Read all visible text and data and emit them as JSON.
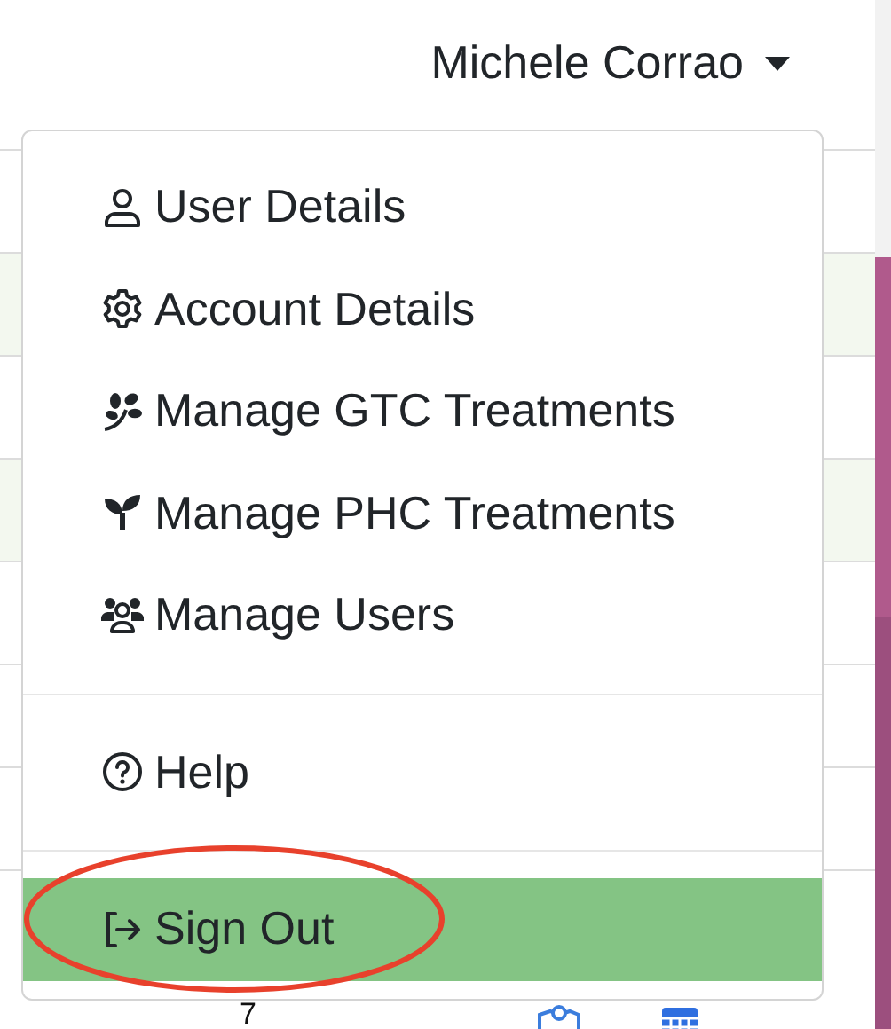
{
  "user_menu": {
    "name": "Michele Corrao",
    "expanded": true
  },
  "menu_sections": [
    {
      "items": [
        {
          "label": "User Details",
          "selected": false
        },
        {
          "label": "Account Details",
          "selected": false
        },
        {
          "label": "Manage GTC Treatments",
          "selected": false
        },
        {
          "label": "Manage PHC Treatments",
          "selected": false
        },
        {
          "label": "Manage Users",
          "selected": false
        }
      ]
    },
    {
      "items": [
        {
          "label": "Help",
          "selected": false
        }
      ]
    },
    {
      "items": [
        {
          "label": "Sign Out",
          "selected": true
        }
      ]
    }
  ],
  "table_row": {
    "column_1": "7"
  },
  "annotation": {
    "kind": "ellipse"
  }
}
